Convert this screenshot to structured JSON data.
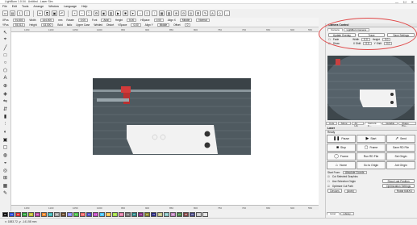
{
  "window": {
    "title": "LightBurn 1.0.04 - Untitled - Laser Sim",
    "min": "—",
    "max": "☐",
    "close": "✕"
  },
  "menu": [
    "File",
    "Edit",
    "Tools",
    "Arrange",
    "Window",
    "Language",
    "Help"
  ],
  "toolbar": {
    "icons": [
      "open-icon",
      "save-icon",
      "import-icon",
      "new-icon",
      "cut-icon",
      "copy-icon",
      "paste-icon",
      "undo-icon",
      "zoom-in-icon",
      "zoom-out-icon",
      "frame-icon",
      "settings-icon",
      "camera-icon",
      "lock-icon",
      "sim-icon",
      "gear-icon"
    ]
  },
  "props": {
    "xpos_label": "XPos",
    "xpos": "91.803",
    "ypos_label": "YPos",
    "ypos": "93.013",
    "width_label": "Width",
    "width_val": "144.000",
    "height_label": "Height",
    "height_val": "43.000",
    "units": "mm",
    "rotate_label": "Rotate",
    "rotate": "0.00",
    "font_label": "Font",
    "font": "Arial",
    "height2_label": "Height",
    "height2": "5.00",
    "hspace_label": "HSpace",
    "hspace": "0.00",
    "align_label": "Align X",
    "align": "Middle",
    "normal": "Normal",
    "bold": "Bold",
    "italic": "Italic",
    "upper": "Upper Case",
    "welded": "Welded",
    "distort": "Distort",
    "vspace_label": "VSpace",
    "vspace": "0.00",
    "align_y_label": "Align Y",
    "align_y": "Middle",
    "offset_label": "Offset",
    "offset": "0"
  },
  "left_tools": [
    "select-icon",
    "edit-nodes-icon",
    "line-icon",
    "rect-icon",
    "ellipse-icon",
    "polygon-icon",
    "text-icon",
    "position-icon",
    "measure-icon",
    "flip-h-icon",
    "flip-v-icon",
    "align-icon",
    "distribute-icon",
    "mirror-icon",
    "group-icon",
    "ungroup-icon",
    "weld-icon",
    "boolean-icon",
    "offset-icon",
    "array-icon",
    "grid-icon",
    "trace-icon"
  ],
  "ruler_top": [
    "1150",
    "1100",
    "1050",
    "1000",
    "950",
    "900",
    "850",
    "800",
    "750",
    "700",
    "650",
    "600",
    "550"
  ],
  "ruler_bottom": [
    "1150",
    "1100",
    "1050",
    "1000",
    "950",
    "900",
    "850",
    "800",
    "750",
    "700",
    "650",
    "600",
    "550"
  ],
  "palette": [
    {
      "label": "00",
      "color": "#000000"
    },
    {
      "label": "01",
      "color": "#1f3fd6"
    },
    {
      "label": "02",
      "color": "#d21f1f"
    },
    {
      "label": "03",
      "color": "#1f9f2f"
    },
    {
      "label": "04",
      "color": "#b9b91f"
    },
    {
      "label": "05",
      "color": "#b3349c"
    },
    {
      "label": "06",
      "color": "#e97f1f"
    },
    {
      "label": "07",
      "color": "#2fb3b3"
    },
    {
      "label": "08",
      "color": "#9f9f9f"
    },
    {
      "label": "09",
      "color": "#5f3f1f"
    },
    {
      "label": "10",
      "color": "#7f7fff"
    },
    {
      "label": "11",
      "color": "#3fbf3f"
    },
    {
      "label": "12",
      "color": "#ff5f5f"
    },
    {
      "label": "13",
      "color": "#3f3fbf"
    },
    {
      "label": "14",
      "color": "#bf3fbf"
    },
    {
      "label": "15",
      "color": "#3fbfff"
    },
    {
      "label": "16",
      "color": "#ffbf3f"
    },
    {
      "label": "17",
      "color": "#9fdf3f"
    },
    {
      "label": "18",
      "color": "#df6f9f"
    },
    {
      "label": "19",
      "color": "#6f6f6f"
    },
    {
      "label": "20",
      "color": "#1f7f7f"
    },
    {
      "label": "21",
      "color": "#7f1f7f"
    },
    {
      "label": "22",
      "color": "#7f7f1f"
    },
    {
      "label": "23",
      "color": "#1f1f7f"
    },
    {
      "label": "24",
      "color": "#bfbf7f"
    },
    {
      "label": "25",
      "color": "#7fbfbf"
    },
    {
      "label": "26",
      "color": "#bf7fbf"
    },
    {
      "label": "27",
      "color": "#3f7f3f"
    },
    {
      "label": "28",
      "color": "#7f3f3f"
    },
    {
      "label": "29",
      "color": "#3f3f7f"
    },
    {
      "label": "T1",
      "color": "#c8c8c8"
    },
    {
      "label": "T2",
      "color": "#e0e0e0"
    }
  ],
  "status": {
    "text": "x: 1883.72, y: -141.58 mm"
  },
  "camera_panel": {
    "title": "Camera Control",
    "tabs": [
      "Camera",
      "LightBurn Camera"
    ],
    "buttons": [
      "Update Overlay",
      "Trace",
      "Save Settings"
    ],
    "fade_label": "Fade",
    "width_label": "Width",
    "width_val": "0.0",
    "height_label": "Height",
    "height_val": "0.0",
    "show_label": "Show",
    "xshift_label": "X Shift",
    "xshift_val": "0.0",
    "yshift_label": "Y Shift",
    "yshift_val": "0.0"
  },
  "bottom_tabs": [
    "Cuts",
    "Move",
    "Art Lib",
    "Camera C...",
    "Variable",
    "Shape Pro..."
  ],
  "laser_panel": {
    "title": "Laser",
    "subtitle": "Ready",
    "pause": "Pause",
    "stop": "Stop",
    "start": "Start",
    "frame": "Frame",
    "frame2": "Frame",
    "send": "Send",
    "save_rd": "Save RD File",
    "run_rd": "Run RD File",
    "home": "Home",
    "go_origin": "Go to Origin",
    "job_origin": "Job Origin",
    "start_from_label": "Start From:",
    "start_from": "Absolute Coords",
    "cut_selected": "Cut Selected Graphics",
    "use_selection_origin": "Use Selection Origin",
    "optimize_cut_path": "Optimize Cut Path",
    "show_last_position": "Show Last Position",
    "optimization_settings": "Optimization Settings",
    "devices": "Devices",
    "device_select": "(Auto)",
    "port": "Ruida 644XG",
    "set_origin": "Set Origin"
  },
  "panel_footer_tabs": [
    "Laser",
    "Library"
  ]
}
